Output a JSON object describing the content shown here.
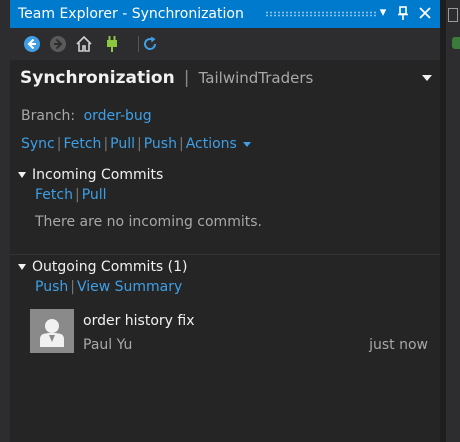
{
  "window": {
    "title": "Team Explorer - Synchronization",
    "controls": {
      "dropdown": "▾",
      "pin": "🖈",
      "close": "✕"
    }
  },
  "toolbar": {
    "icons": [
      "back-icon",
      "forward-icon",
      "home-icon",
      "connect-icon",
      "refresh-icon"
    ]
  },
  "header": {
    "title": "Synchronization",
    "separator": "|",
    "context": "TailwindTraders"
  },
  "branch": {
    "label": "Branch:",
    "value": "order-bug"
  },
  "actions": {
    "items": [
      "Sync",
      "Fetch",
      "Pull",
      "Push",
      "Actions"
    ],
    "separator": "|"
  },
  "incoming": {
    "title": "Incoming Commits",
    "links": [
      "Fetch",
      "Pull"
    ],
    "empty_text": "There are no incoming commits."
  },
  "outgoing": {
    "title": "Outgoing Commits (1)",
    "links": [
      "Push",
      "View Summary"
    ],
    "commits": [
      {
        "message": "order history fix",
        "author": "Paul Yu",
        "time": "just now"
      }
    ]
  },
  "colors": {
    "accent": "#007acc",
    "link": "#3e9fe6",
    "background": "#252526"
  }
}
